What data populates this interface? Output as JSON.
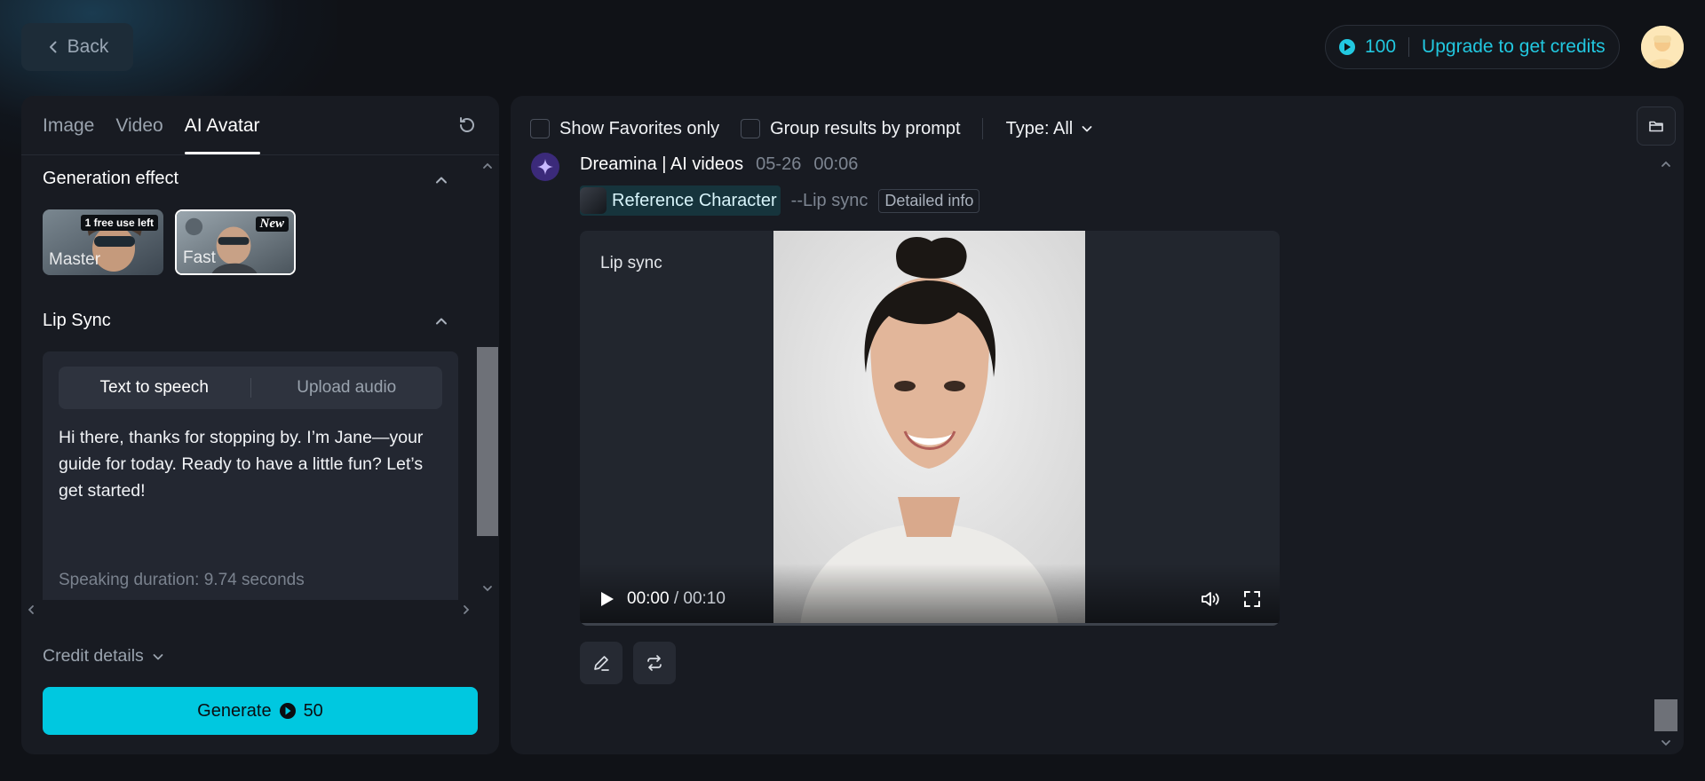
{
  "header": {
    "back_label": "Back",
    "credits": "100",
    "upgrade_label": "Upgrade to get credits"
  },
  "left_panel": {
    "tabs": [
      {
        "label": "Image",
        "active": false
      },
      {
        "label": "Video",
        "active": false
      },
      {
        "label": "AI Avatar",
        "active": true
      }
    ],
    "generation_effect": {
      "title": "Generation effect",
      "options": [
        {
          "label": "Master",
          "badge": "1 free use left",
          "selected": false
        },
        {
          "label": "Fast",
          "badge": "New",
          "selected": true
        }
      ]
    },
    "lip_sync": {
      "title": "Lip Sync",
      "modes": [
        "Text to speech",
        "Upload audio"
      ],
      "active_mode": "Text to speech",
      "text": "Hi there, thanks for stopping by. I’m Jane—your guide for today. Ready to have a little fun? Let’s get started!",
      "duration": "Speaking duration: 9.74 seconds"
    },
    "credit_details_label": "Credit details",
    "generate": {
      "label": "Generate",
      "cost": "50"
    }
  },
  "right_panel": {
    "filters": {
      "favorites_label": "Show Favorites only",
      "favorites_checked": false,
      "group_label": "Group results by prompt",
      "group_checked": false,
      "type_label": "Type: All"
    },
    "result": {
      "author": "Dreamina | AI videos",
      "date": "05-26",
      "time": "00:06",
      "reference_label": "Reference Character",
      "mode_tag": "--Lip sync",
      "detail_label": "Detailed info",
      "video": {
        "overlay_label": "Lip sync",
        "current_time": "00:00",
        "separator": "/",
        "duration": "00:10"
      }
    }
  },
  "icons": {
    "back": "chevron-left-icon",
    "coin": "credit-coin-icon",
    "reset": "refresh-icon",
    "folder": "folder-icon",
    "edit": "pencil-icon",
    "regenerate": "repeat-icon",
    "play": "play-icon",
    "volume": "volume-icon",
    "fullscreen": "fullscreen-icon"
  },
  "colors": {
    "accent": "#00c8e0",
    "background": "#101217",
    "panel": "#181b22"
  }
}
